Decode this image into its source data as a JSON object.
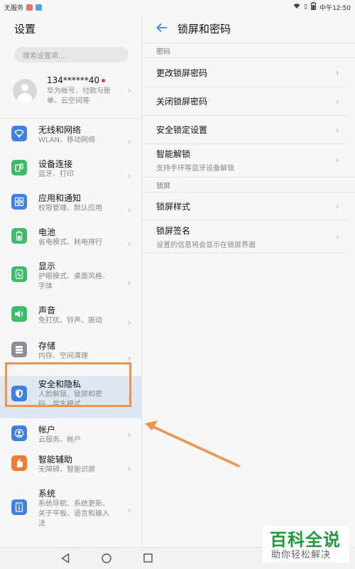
{
  "status_bar": {
    "carrier": "无服务",
    "time": "中午12:50"
  },
  "left": {
    "title": "设置",
    "search_placeholder": "搜索设置项...",
    "account": {
      "name": "134******40",
      "subtitle": "华为帐号、付款与账单、云空间等"
    },
    "items": [
      {
        "title": "无线和网络",
        "subtitle": "WLAN、移动网络",
        "icon": "wifi-icon",
        "color": "#3f7fe8"
      },
      {
        "title": "设备连接",
        "subtitle": "蓝牙、打印",
        "icon": "device-connect-icon",
        "color": "#3bbd6b"
      },
      {
        "title": "应用和通知",
        "subtitle": "权限管理、默认应用",
        "icon": "apps-icon",
        "color": "#3f7fe8"
      },
      {
        "title": "电池",
        "subtitle": "省电模式、耗电排行",
        "icon": "battery-icon",
        "color": "#3bbd6b"
      },
      {
        "title": "显示",
        "subtitle": "护眼模式、桌面风格、 字体",
        "icon": "display-icon",
        "color": "#3bbd6b"
      },
      {
        "title": "声音",
        "subtitle": "免打扰、铃声、振动",
        "icon": "sound-icon",
        "color": "#3bbd6b"
      },
      {
        "title": "存储",
        "subtitle": "内存、空间清理",
        "icon": "storage-icon",
        "color": "#8a8f96"
      },
      {
        "title": "安全和隐私",
        "subtitle": "人脸解锁、锁屏和密码、学生模式",
        "icon": "shield-icon",
        "color": "#3f7fe8"
      },
      {
        "title": "帐户",
        "subtitle": "云服务、帐户",
        "icon": "account-icon",
        "color": "#3f7fe8"
      },
      {
        "title": "智能辅助",
        "subtitle": "无障碍、智能识屏",
        "icon": "hand-icon",
        "color": "#ef7d2f"
      },
      {
        "title": "系统",
        "subtitle": "系统导航、系统更新、关于平板、语言和输入法",
        "icon": "info-icon",
        "color": "#3f7fe8"
      }
    ]
  },
  "right": {
    "title": "锁屏和密码",
    "sections": [
      {
        "header": "密码",
        "items": [
          {
            "title": "更改锁屏密码",
            "subtitle": ""
          },
          {
            "title": "关闭锁屏密码",
            "subtitle": ""
          },
          {
            "title": "安全锁定设置",
            "subtitle": ""
          },
          {
            "title": "智能解锁",
            "subtitle": "支持手环等蓝牙设备解锁"
          }
        ]
      },
      {
        "header": "锁屏",
        "items": [
          {
            "title": "锁屏样式",
            "subtitle": ""
          },
          {
            "title": "锁屏签名",
            "subtitle": "设置的信息将会显示在锁屏界面"
          }
        ]
      }
    ]
  },
  "watermark": {
    "title": "百科全说",
    "subtitle": "助你轻松解决"
  },
  "colors": {
    "accent": "#2d8de0",
    "highlight": "#f0934a"
  }
}
